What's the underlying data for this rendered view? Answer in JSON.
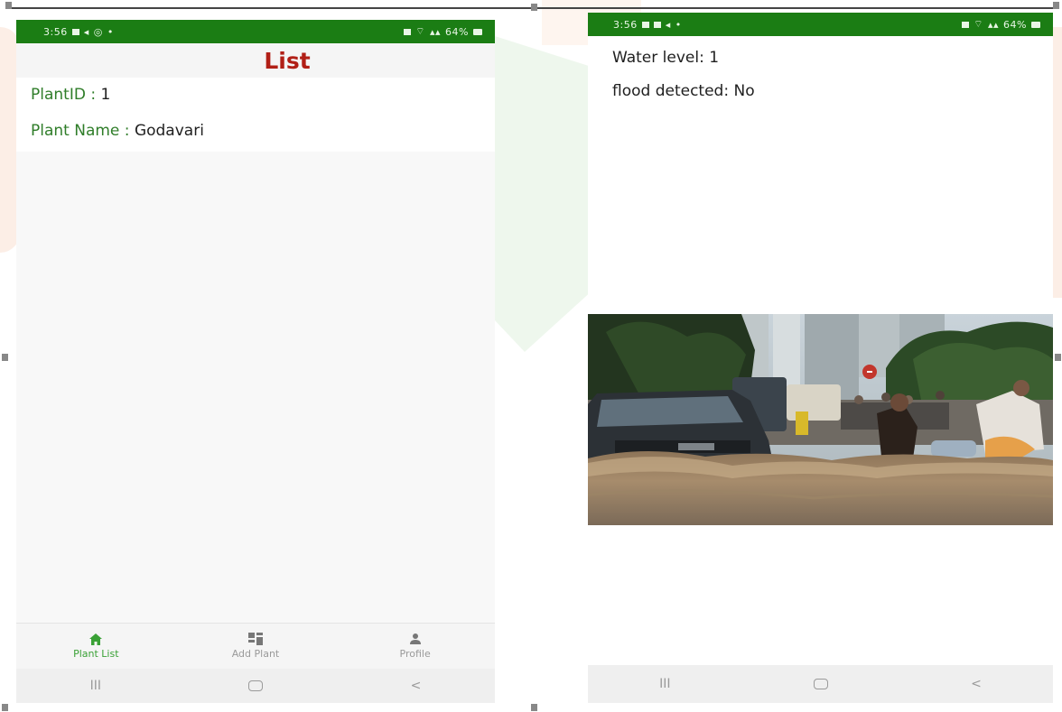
{
  "left_screen": {
    "status": {
      "time": "3:56",
      "battery": "64%"
    },
    "title": "List",
    "plant": {
      "id_label": "PlantID : ",
      "id_value": "1",
      "name_label": "Plant Name : ",
      "name_value": "Godavari"
    },
    "bottom_nav": [
      {
        "label": "Plant List",
        "icon": "home-icon",
        "active": true
      },
      {
        "label": "Add Plant",
        "icon": "grid-icon",
        "active": false
      },
      {
        "label": "Profile",
        "icon": "person-icon",
        "active": false
      }
    ],
    "system_nav": {
      "recents": "III",
      "back": "<"
    }
  },
  "right_screen": {
    "status": {
      "time": "3:56",
      "battery": "64%"
    },
    "water_level_label": "Water level:",
    "water_level_value": "1",
    "flood_label": "flood detected:",
    "flood_value": "No",
    "photo": "flood-street-photo",
    "system_nav": {
      "recents": "III",
      "back": "<"
    }
  },
  "colors": {
    "status_bar": "#1b7d14",
    "title": "#b11f16",
    "field_label": "#2f7d29",
    "nav_active": "#3aa136"
  }
}
